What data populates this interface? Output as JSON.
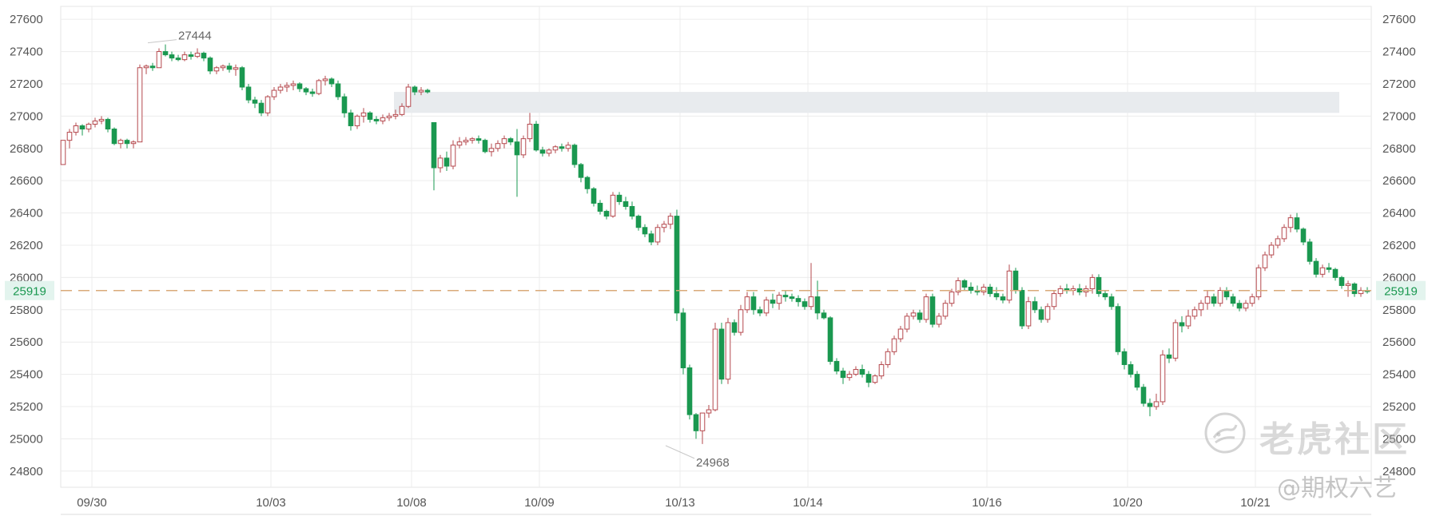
{
  "chart_data": {
    "type": "candlestick",
    "title": "",
    "xlabel": "",
    "ylabel": "",
    "ylim": [
      24700,
      27680
    ],
    "yticks": [
      24800,
      25000,
      25200,
      25400,
      25600,
      25800,
      26000,
      26200,
      26400,
      26600,
      26800,
      27000,
      27200,
      27400,
      27600
    ],
    "date_labels": [
      {
        "label": "09/30",
        "i": 2
      },
      {
        "label": "10/03",
        "i": 30
      },
      {
        "label": "10/08",
        "i": 52
      },
      {
        "label": "10/09",
        "i": 72
      },
      {
        "label": "10/13",
        "i": 94
      },
      {
        "label": "10/14",
        "i": 114
      },
      {
        "label": "10/16",
        "i": 142
      },
      {
        "label": "10/20",
        "i": 164
      },
      {
        "label": "10/21",
        "i": 184
      }
    ],
    "current_price": 25919,
    "current_price_label": "25919",
    "annotations": [
      {
        "label": "27444",
        "value": 27444,
        "i": 13
      },
      {
        "label": "24968",
        "value": 24968,
        "i": 94
      }
    ],
    "shaded_zone": {
      "from": 27020,
      "to": 27150,
      "start_i": 52
    },
    "colors": {
      "up": "#b5484d",
      "down": "#1a9850",
      "price_line": "#d9aa7a",
      "price_tag_bg": "#e3f4ee",
      "price_tag_text": "#1a9850",
      "grid": "#ececec",
      "axis_text": "#555555",
      "zone": "#e8ebee"
    },
    "grid": true,
    "candles": [
      [
        26700,
        26850,
        26700,
        26850
      ],
      [
        26850,
        26920,
        26800,
        26900
      ],
      [
        26900,
        26960,
        26880,
        26940
      ],
      [
        26940,
        26950,
        26880,
        26920
      ],
      [
        26920,
        26960,
        26900,
        26950
      ],
      [
        26950,
        26990,
        26930,
        26970
      ],
      [
        26970,
        27000,
        26950,
        26980
      ],
      [
        26980,
        26990,
        26900,
        26920
      ],
      [
        26920,
        26930,
        26820,
        26830
      ],
      [
        26830,
        26860,
        26800,
        26850
      ],
      [
        26850,
        26860,
        26800,
        26830
      ],
      [
        26830,
        26850,
        26800,
        26840
      ],
      [
        26840,
        27320,
        26850,
        27300
      ],
      [
        27300,
        27320,
        27260,
        27310
      ],
      [
        27310,
        27330,
        27280,
        27300
      ],
      [
        27300,
        27420,
        27300,
        27400
      ],
      [
        27400,
        27444,
        27370,
        27380
      ],
      [
        27380,
        27400,
        27340,
        27360
      ],
      [
        27360,
        27380,
        27340,
        27350
      ],
      [
        27350,
        27400,
        27340,
        27380
      ],
      [
        27380,
        27400,
        27350,
        27370
      ],
      [
        27370,
        27420,
        27360,
        27390
      ],
      [
        27390,
        27400,
        27340,
        27360
      ],
      [
        27360,
        27370,
        27260,
        27280
      ],
      [
        27280,
        27310,
        27260,
        27300
      ],
      [
        27300,
        27320,
        27280,
        27310
      ],
      [
        27310,
        27330,
        27270,
        27290
      ],
      [
        27290,
        27320,
        27250,
        27300
      ],
      [
        27300,
        27310,
        27160,
        27180
      ],
      [
        27180,
        27200,
        27080,
        27100
      ],
      [
        27100,
        27120,
        27050,
        27080
      ],
      [
        27080,
        27100,
        27000,
        27020
      ],
      [
        27020,
        27130,
        27000,
        27120
      ],
      [
        27120,
        27180,
        27100,
        27160
      ],
      [
        27160,
        27200,
        27140,
        27180
      ],
      [
        27180,
        27210,
        27150,
        27190
      ],
      [
        27190,
        27220,
        27160,
        27200
      ],
      [
        27200,
        27210,
        27150,
        27170
      ],
      [
        27170,
        27180,
        27130,
        27150
      ],
      [
        27150,
        27170,
        27120,
        27140
      ],
      [
        27140,
        27230,
        27130,
        27220
      ],
      [
        27220,
        27250,
        27190,
        27230
      ],
      [
        27230,
        27240,
        27180,
        27200
      ],
      [
        27200,
        27220,
        27100,
        27120
      ],
      [
        27120,
        27140,
        26990,
        27020
      ],
      [
        27020,
        27040,
        26910,
        26940
      ],
      [
        26940,
        27010,
        26920,
        27000
      ],
      [
        27000,
        27050,
        26960,
        27020
      ],
      [
        27020,
        27030,
        26960,
        26980
      ],
      [
        26980,
        27000,
        26950,
        26970
      ],
      [
        26970,
        27010,
        26950,
        26990
      ],
      [
        26990,
        27020,
        26970,
        27000
      ],
      [
        27000,
        27040,
        26980,
        27010
      ],
      [
        27010,
        27080,
        27000,
        27060
      ],
      [
        27060,
        27200,
        27050,
        27180
      ],
      [
        27180,
        27190,
        27130,
        27150
      ],
      [
        27150,
        27180,
        27130,
        27160
      ],
      [
        27160,
        27170,
        27140,
        27150
      ],
      [
        26960,
        26960,
        26540,
        26680
      ],
      [
        26680,
        26760,
        26650,
        26740
      ],
      [
        26740,
        26780,
        26660,
        26690
      ],
      [
        26690,
        26850,
        26670,
        26820
      ],
      [
        26820,
        26870,
        26800,
        26840
      ],
      [
        26840,
        26870,
        26820,
        26850
      ],
      [
        26850,
        26870,
        26830,
        26860
      ],
      [
        26860,
        26880,
        26830,
        26850
      ],
      [
        26850,
        26860,
        26770,
        26780
      ],
      [
        26780,
        26830,
        26750,
        26800
      ],
      [
        26800,
        26850,
        26780,
        26830
      ],
      [
        26830,
        26880,
        26800,
        26860
      ],
      [
        26860,
        26870,
        26820,
        26840
      ],
      [
        26840,
        26920,
        26500,
        26760
      ],
      [
        26760,
        26880,
        26740,
        26860
      ],
      [
        26860,
        27020,
        26840,
        26950
      ],
      [
        26950,
        26970,
        26780,
        26790
      ],
      [
        26790,
        26810,
        26750,
        26770
      ],
      [
        26770,
        26800,
        26750,
        26790
      ],
      [
        26790,
        26820,
        26770,
        26810
      ],
      [
        26810,
        26830,
        26780,
        26800
      ],
      [
        26800,
        26840,
        26780,
        26820
      ],
      [
        26820,
        26830,
        26680,
        26700
      ],
      [
        26700,
        26710,
        26590,
        26620
      ],
      [
        26620,
        26630,
        26520,
        26550
      ],
      [
        26550,
        26560,
        26440,
        26460
      ],
      [
        26460,
        26480,
        26390,
        26410
      ],
      [
        26410,
        26420,
        26360,
        26380
      ],
      [
        26380,
        26530,
        26370,
        26510
      ],
      [
        26510,
        26530,
        26450,
        26470
      ],
      [
        26470,
        26500,
        26420,
        26440
      ],
      [
        26440,
        26470,
        26360,
        26380
      ],
      [
        26380,
        26390,
        26290,
        26310
      ],
      [
        26310,
        26330,
        26250,
        26270
      ],
      [
        26270,
        26290,
        26200,
        26220
      ],
      [
        26220,
        26330,
        26200,
        26310
      ],
      [
        26310,
        26350,
        26280,
        26330
      ],
      [
        26330,
        26400,
        26300,
        26380
      ],
      [
        26380,
        26420,
        25730,
        25780
      ],
      [
        25780,
        25810,
        25400,
        25440
      ],
      [
        25440,
        25460,
        25120,
        25150
      ],
      [
        25150,
        25160,
        25000,
        25050
      ],
      [
        25050,
        25160,
        24968,
        25160
      ],
      [
        25160,
        25210,
        25130,
        25180
      ],
      [
        25180,
        25720,
        25170,
        25680
      ],
      [
        25680,
        25720,
        25340,
        25370
      ],
      [
        25370,
        25750,
        25340,
        25720
      ],
      [
        25720,
        25740,
        25640,
        25660
      ],
      [
        25660,
        25830,
        25640,
        25800
      ],
      [
        25800,
        25910,
        25780,
        25880
      ],
      [
        25880,
        25910,
        25770,
        25800
      ],
      [
        25800,
        25820,
        25760,
        25780
      ],
      [
        25780,
        25880,
        25760,
        25860
      ],
      [
        25860,
        25900,
        25810,
        25840
      ],
      [
        25840,
        25910,
        25800,
        25890
      ],
      [
        25890,
        25920,
        25850,
        25880
      ],
      [
        25880,
        25900,
        25850,
        25870
      ],
      [
        25870,
        25890,
        25820,
        25850
      ],
      [
        25850,
        25870,
        25800,
        25820
      ],
      [
        25820,
        26090,
        25800,
        25880
      ],
      [
        25880,
        25980,
        25740,
        25780
      ],
      [
        25780,
        25800,
        25740,
        25750
      ],
      [
        25750,
        25760,
        25460,
        25480
      ],
      [
        25480,
        25500,
        25400,
        25420
      ],
      [
        25420,
        25440,
        25340,
        25380
      ],
      [
        25380,
        25420,
        25360,
        25400
      ],
      [
        25400,
        25450,
        25390,
        25430
      ],
      [
        25430,
        25460,
        25380,
        25400
      ],
      [
        25400,
        25420,
        25320,
        25350
      ],
      [
        25350,
        25400,
        25340,
        25390
      ],
      [
        25390,
        25480,
        25370,
        25460
      ],
      [
        25460,
        25560,
        25440,
        25540
      ],
      [
        25540,
        25640,
        25520,
        25620
      ],
      [
        25620,
        25700,
        25600,
        25680
      ],
      [
        25680,
        25780,
        25660,
        25760
      ],
      [
        25760,
        25800,
        25740,
        25780
      ],
      [
        25780,
        25800,
        25720,
        25740
      ],
      [
        25740,
        25900,
        25720,
        25880
      ],
      [
        25880,
        25900,
        25690,
        25710
      ],
      [
        25710,
        25780,
        25690,
        25760
      ],
      [
        25760,
        25860,
        25740,
        25840
      ],
      [
        25840,
        25930,
        25820,
        25910
      ],
      [
        25910,
        26000,
        25890,
        25980
      ],
      [
        25980,
        25990,
        25920,
        25940
      ],
      [
        25940,
        25970,
        25900,
        25920
      ],
      [
        25920,
        25950,
        25890,
        25910
      ],
      [
        25910,
        25960,
        25890,
        25940
      ],
      [
        25940,
        25960,
        25880,
        25900
      ],
      [
        25900,
        25940,
        25860,
        25880
      ],
      [
        25880,
        25900,
        25840,
        25860
      ],
      [
        25860,
        26080,
        25840,
        26040
      ],
      [
        26040,
        26060,
        25900,
        25920
      ],
      [
        25920,
        25940,
        25680,
        25700
      ],
      [
        25700,
        25880,
        25680,
        25850
      ],
      [
        25850,
        25880,
        25780,
        25800
      ],
      [
        25800,
        25820,
        25720,
        25740
      ],
      [
        25740,
        25840,
        25720,
        25820
      ],
      [
        25820,
        25920,
        25800,
        25900
      ],
      [
        25900,
        25950,
        25880,
        25930
      ],
      [
        25930,
        25960,
        25900,
        25920
      ],
      [
        25920,
        25950,
        25890,
        25930
      ],
      [
        25930,
        25960,
        25890,
        25910
      ],
      [
        25910,
        25950,
        25880,
        25930
      ],
      [
        25930,
        26020,
        25900,
        26000
      ],
      [
        26000,
        26020,
        25880,
        25900
      ],
      [
        25900,
        25920,
        25860,
        25880
      ],
      [
        25880,
        25900,
        25800,
        25820
      ],
      [
        25820,
        25840,
        25520,
        25540
      ],
      [
        25540,
        25560,
        25430,
        25460
      ],
      [
        25460,
        25480,
        25380,
        25400
      ],
      [
        25400,
        25420,
        25300,
        25320
      ],
      [
        25320,
        25340,
        25200,
        25220
      ],
      [
        25220,
        25250,
        25140,
        25200
      ],
      [
        25200,
        25280,
        25180,
        25230
      ],
      [
        25230,
        25550,
        25210,
        25520
      ],
      [
        25520,
        25560,
        25470,
        25500
      ],
      [
        25500,
        25740,
        25480,
        25720
      ],
      [
        25720,
        25760,
        25660,
        25700
      ],
      [
        25700,
        25800,
        25680,
        25760
      ],
      [
        25760,
        25820,
        25740,
        25800
      ],
      [
        25800,
        25860,
        25760,
        25840
      ],
      [
        25840,
        25920,
        25800,
        25880
      ],
      [
        25880,
        25900,
        25820,
        25840
      ],
      [
        25840,
        25940,
        25820,
        25920
      ],
      [
        25920,
        25940,
        25860,
        25880
      ],
      [
        25880,
        25900,
        25820,
        25840
      ],
      [
        25840,
        25860,
        25790,
        25810
      ],
      [
        25810,
        25860,
        25790,
        25840
      ],
      [
        25840,
        25900,
        25820,
        25880
      ],
      [
        25880,
        26080,
        25860,
        26060
      ],
      [
        26060,
        26160,
        26040,
        26140
      ],
      [
        26140,
        26220,
        26120,
        26200
      ],
      [
        26200,
        26260,
        26180,
        26240
      ],
      [
        26240,
        26330,
        26220,
        26310
      ],
      [
        26310,
        26390,
        26280,
        26370
      ],
      [
        26370,
        26400,
        26280,
        26300
      ],
      [
        26300,
        26310,
        26200,
        26220
      ],
      [
        26220,
        26240,
        26080,
        26100
      ],
      [
        26100,
        26120,
        26000,
        26020
      ],
      [
        26020,
        26080,
        26000,
        26060
      ],
      [
        26060,
        26090,
        26030,
        26050
      ],
      [
        26050,
        26060,
        25980,
        26000
      ],
      [
        26000,
        26010,
        25930,
        25950
      ],
      [
        25950,
        25980,
        25880,
        25960
      ],
      [
        25960,
        25970,
        25880,
        25900
      ],
      [
        25900,
        25940,
        25880,
        25920
      ],
      [
        25920,
        25940,
        25900,
        25919
      ]
    ]
  },
  "watermark": {
    "brand": "老虎社区",
    "handle": "@期权六艺",
    "logo_icon": "tiger-logo-icon"
  }
}
